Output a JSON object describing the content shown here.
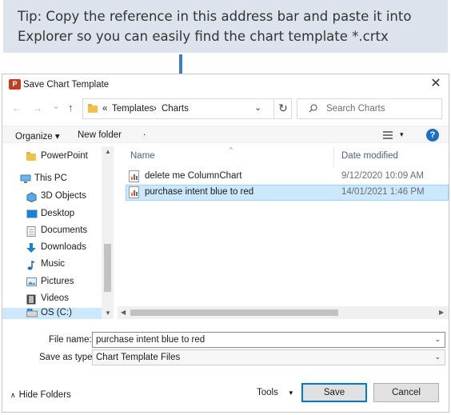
{
  "tip": {
    "line1": "Tip: Copy the reference in this address bar and paste it into",
    "line2": "Explorer so you can easily find the chart template *.crtx"
  },
  "colors": {
    "tip_bg": "#dde3ec",
    "arrow": "#3d7ebf",
    "accent": "#0078d7",
    "selection": "#cce8ff"
  },
  "dialog": {
    "title": "Save Chart Template",
    "close_symbol": "✕",
    "nav": {
      "back": "←",
      "forward": "→",
      "dropdown": "⌄",
      "up": "↑",
      "breadcrumb_overflow": "«",
      "breadcrumbs": [
        "Templates",
        "Charts"
      ],
      "separator": "›",
      "address_chevron": "⌄",
      "refresh": "↻"
    },
    "search": {
      "placeholder": "Search Charts",
      "icon": "search-icon"
    },
    "toolbar": {
      "organize": "Organize ▾",
      "new_folder": "New folder",
      "dot": ".",
      "view_caret": "▾",
      "help": "?"
    },
    "sidebar": {
      "items": [
        {
          "label": "PowerPoint",
          "icon": "folder-icon"
        },
        {
          "label": "This PC",
          "icon": "this-pc-icon"
        },
        {
          "label": "3D Objects",
          "icon": "3d-objects-icon"
        },
        {
          "label": "Desktop",
          "icon": "desktop-icon"
        },
        {
          "label": "Documents",
          "icon": "documents-icon"
        },
        {
          "label": "Downloads",
          "icon": "downloads-icon"
        },
        {
          "label": "Music",
          "icon": "music-icon"
        },
        {
          "label": "Pictures",
          "icon": "pictures-icon"
        },
        {
          "label": "Videos",
          "icon": "videos-icon"
        },
        {
          "label": "OS (C:)",
          "icon": "drive-icon"
        }
      ]
    },
    "files": {
      "columns": {
        "name": "Name",
        "date": "Date modified"
      },
      "rows": [
        {
          "name": "delete me ColumnChart",
          "date": "9/12/2020 10:09 AM",
          "selected": false
        },
        {
          "name": "purchase intent blue to red",
          "date": "14/01/2021 1:46 PM",
          "selected": true
        }
      ]
    },
    "form": {
      "file_name_label": "File name:",
      "file_name_value": "purchase intent blue to red",
      "save_type_label": "Save as type:",
      "save_type_value": "Chart Template Files",
      "chevron": "⌄"
    },
    "footer": {
      "hide_folders": "Hide Folders",
      "hide_caret": "∧",
      "tools": "Tools",
      "tools_caret": "▼",
      "save": "Save",
      "cancel": "Cancel"
    }
  }
}
